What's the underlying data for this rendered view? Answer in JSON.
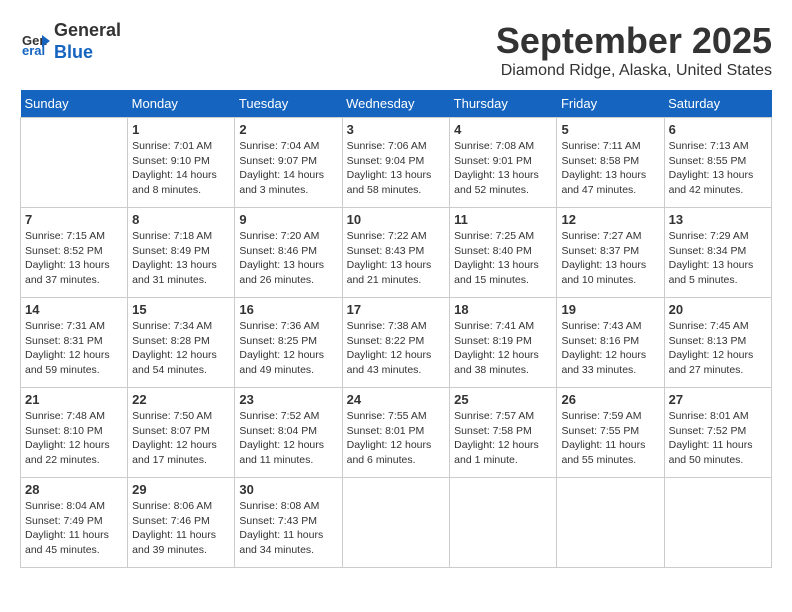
{
  "header": {
    "logo_line1": "General",
    "logo_line2": "Blue",
    "month_title": "September 2025",
    "location": "Diamond Ridge, Alaska, United States"
  },
  "weekdays": [
    "Sunday",
    "Monday",
    "Tuesday",
    "Wednesday",
    "Thursday",
    "Friday",
    "Saturday"
  ],
  "weeks": [
    [
      {
        "day": "",
        "info": ""
      },
      {
        "day": "1",
        "info": "Sunrise: 7:01 AM\nSunset: 9:10 PM\nDaylight: 14 hours\nand 8 minutes."
      },
      {
        "day": "2",
        "info": "Sunrise: 7:04 AM\nSunset: 9:07 PM\nDaylight: 14 hours\nand 3 minutes."
      },
      {
        "day": "3",
        "info": "Sunrise: 7:06 AM\nSunset: 9:04 PM\nDaylight: 13 hours\nand 58 minutes."
      },
      {
        "day": "4",
        "info": "Sunrise: 7:08 AM\nSunset: 9:01 PM\nDaylight: 13 hours\nand 52 minutes."
      },
      {
        "day": "5",
        "info": "Sunrise: 7:11 AM\nSunset: 8:58 PM\nDaylight: 13 hours\nand 47 minutes."
      },
      {
        "day": "6",
        "info": "Sunrise: 7:13 AM\nSunset: 8:55 PM\nDaylight: 13 hours\nand 42 minutes."
      }
    ],
    [
      {
        "day": "7",
        "info": "Sunrise: 7:15 AM\nSunset: 8:52 PM\nDaylight: 13 hours\nand 37 minutes."
      },
      {
        "day": "8",
        "info": "Sunrise: 7:18 AM\nSunset: 8:49 PM\nDaylight: 13 hours\nand 31 minutes."
      },
      {
        "day": "9",
        "info": "Sunrise: 7:20 AM\nSunset: 8:46 PM\nDaylight: 13 hours\nand 26 minutes."
      },
      {
        "day": "10",
        "info": "Sunrise: 7:22 AM\nSunset: 8:43 PM\nDaylight: 13 hours\nand 21 minutes."
      },
      {
        "day": "11",
        "info": "Sunrise: 7:25 AM\nSunset: 8:40 PM\nDaylight: 13 hours\nand 15 minutes."
      },
      {
        "day": "12",
        "info": "Sunrise: 7:27 AM\nSunset: 8:37 PM\nDaylight: 13 hours\nand 10 minutes."
      },
      {
        "day": "13",
        "info": "Sunrise: 7:29 AM\nSunset: 8:34 PM\nDaylight: 13 hours\nand 5 minutes."
      }
    ],
    [
      {
        "day": "14",
        "info": "Sunrise: 7:31 AM\nSunset: 8:31 PM\nDaylight: 12 hours\nand 59 minutes."
      },
      {
        "day": "15",
        "info": "Sunrise: 7:34 AM\nSunset: 8:28 PM\nDaylight: 12 hours\nand 54 minutes."
      },
      {
        "day": "16",
        "info": "Sunrise: 7:36 AM\nSunset: 8:25 PM\nDaylight: 12 hours\nand 49 minutes."
      },
      {
        "day": "17",
        "info": "Sunrise: 7:38 AM\nSunset: 8:22 PM\nDaylight: 12 hours\nand 43 minutes."
      },
      {
        "day": "18",
        "info": "Sunrise: 7:41 AM\nSunset: 8:19 PM\nDaylight: 12 hours\nand 38 minutes."
      },
      {
        "day": "19",
        "info": "Sunrise: 7:43 AM\nSunset: 8:16 PM\nDaylight: 12 hours\nand 33 minutes."
      },
      {
        "day": "20",
        "info": "Sunrise: 7:45 AM\nSunset: 8:13 PM\nDaylight: 12 hours\nand 27 minutes."
      }
    ],
    [
      {
        "day": "21",
        "info": "Sunrise: 7:48 AM\nSunset: 8:10 PM\nDaylight: 12 hours\nand 22 minutes."
      },
      {
        "day": "22",
        "info": "Sunrise: 7:50 AM\nSunset: 8:07 PM\nDaylight: 12 hours\nand 17 minutes."
      },
      {
        "day": "23",
        "info": "Sunrise: 7:52 AM\nSunset: 8:04 PM\nDaylight: 12 hours\nand 11 minutes."
      },
      {
        "day": "24",
        "info": "Sunrise: 7:55 AM\nSunset: 8:01 PM\nDaylight: 12 hours\nand 6 minutes."
      },
      {
        "day": "25",
        "info": "Sunrise: 7:57 AM\nSunset: 7:58 PM\nDaylight: 12 hours\nand 1 minute."
      },
      {
        "day": "26",
        "info": "Sunrise: 7:59 AM\nSunset: 7:55 PM\nDaylight: 11 hours\nand 55 minutes."
      },
      {
        "day": "27",
        "info": "Sunrise: 8:01 AM\nSunset: 7:52 PM\nDaylight: 11 hours\nand 50 minutes."
      }
    ],
    [
      {
        "day": "28",
        "info": "Sunrise: 8:04 AM\nSunset: 7:49 PM\nDaylight: 11 hours\nand 45 minutes."
      },
      {
        "day": "29",
        "info": "Sunrise: 8:06 AM\nSunset: 7:46 PM\nDaylight: 11 hours\nand 39 minutes."
      },
      {
        "day": "30",
        "info": "Sunrise: 8:08 AM\nSunset: 7:43 PM\nDaylight: 11 hours\nand 34 minutes."
      },
      {
        "day": "",
        "info": ""
      },
      {
        "day": "",
        "info": ""
      },
      {
        "day": "",
        "info": ""
      },
      {
        "day": "",
        "info": ""
      }
    ]
  ]
}
